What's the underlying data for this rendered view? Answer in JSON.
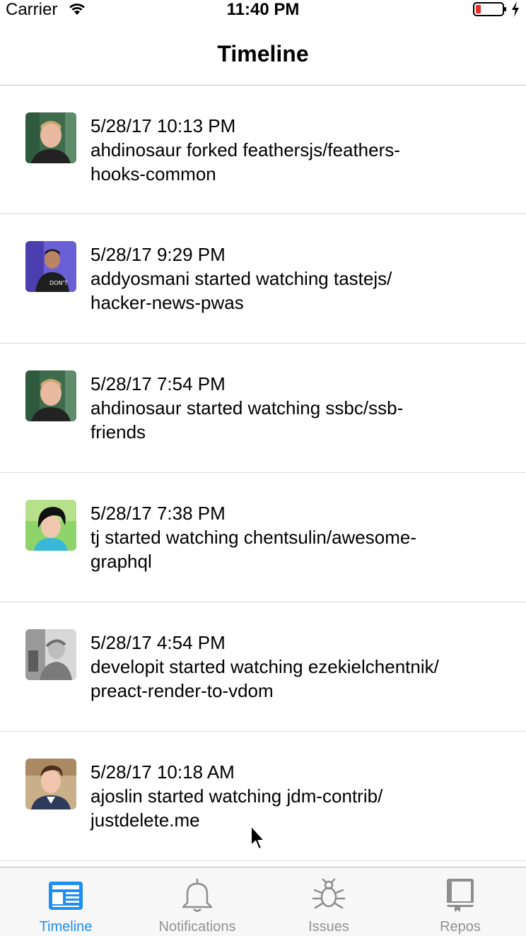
{
  "status_bar": {
    "carrier": "Carrier",
    "time": "11:40 PM",
    "battery_color": "#e8302f"
  },
  "nav": {
    "title": "Timeline"
  },
  "timeline": [
    {
      "time": "5/28/17 10:13 PM",
      "line1": "ahdinosaur forked feathersjs/feathers-",
      "line2": "hooks-common",
      "avatar": "avatar-ahdinosaur"
    },
    {
      "time": "5/28/17 9:29 PM",
      "line1": "addyosmani started watching tastejs/",
      "line2": "hacker-news-pwas",
      "avatar": "avatar-addyosmani"
    },
    {
      "time": "5/28/17 7:54 PM",
      "line1": "ahdinosaur started watching ssbc/ssb-",
      "line2": "friends",
      "avatar": "avatar-ahdinosaur"
    },
    {
      "time": "5/28/17 7:38 PM",
      "line1": "tj started watching chentsulin/awesome-",
      "line2": "graphql",
      "avatar": "avatar-tj"
    },
    {
      "time": "5/28/17 4:54 PM",
      "line1": "developit started watching ezekielchentnik/",
      "line2": "preact-render-to-vdom",
      "avatar": "avatar-developit"
    },
    {
      "time": "5/28/17 10:18 AM",
      "line1": "ajoslin started watching jdm-contrib/",
      "line2": "justdelete.me",
      "avatar": "avatar-ajoslin"
    }
  ],
  "tabs": [
    {
      "label": "Timeline",
      "icon": "newspaper-icon",
      "active": true
    },
    {
      "label": "Notifications",
      "icon": "bell-icon",
      "active": false
    },
    {
      "label": "Issues",
      "icon": "bug-icon",
      "active": false
    },
    {
      "label": "Repos",
      "icon": "book-icon",
      "active": false
    }
  ],
  "colors": {
    "accent": "#1e8ff2",
    "tab_inactive": "#929292",
    "separator": "#d9d9d9"
  }
}
